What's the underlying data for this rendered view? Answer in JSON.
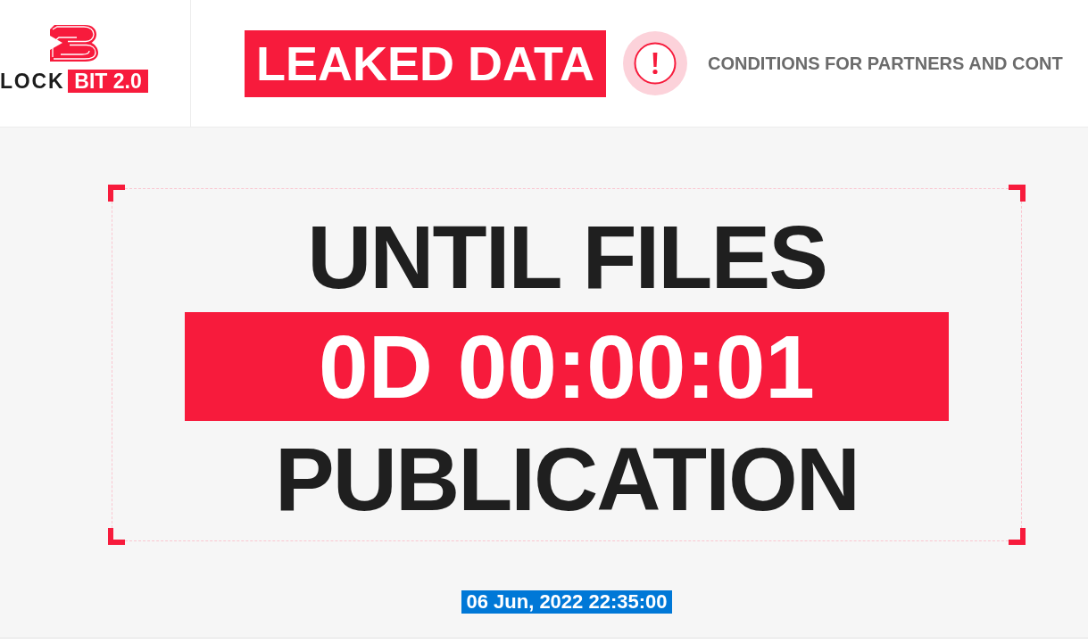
{
  "header": {
    "logo": {
      "word": "LOCK",
      "tag": "BIT 2.0"
    },
    "leaked_data_button": "LEAKED DATA",
    "conditions_link": "CONDITIONS FOR PARTNERS AND CONT"
  },
  "countdown": {
    "title_top": "UNTIL FILES",
    "timer": "0D 00:00:01",
    "title_bottom": "PUBLICATION"
  },
  "publish_date": {
    "text": "06 Jun, 2022 22:35:00",
    "highlighted": true
  }
}
